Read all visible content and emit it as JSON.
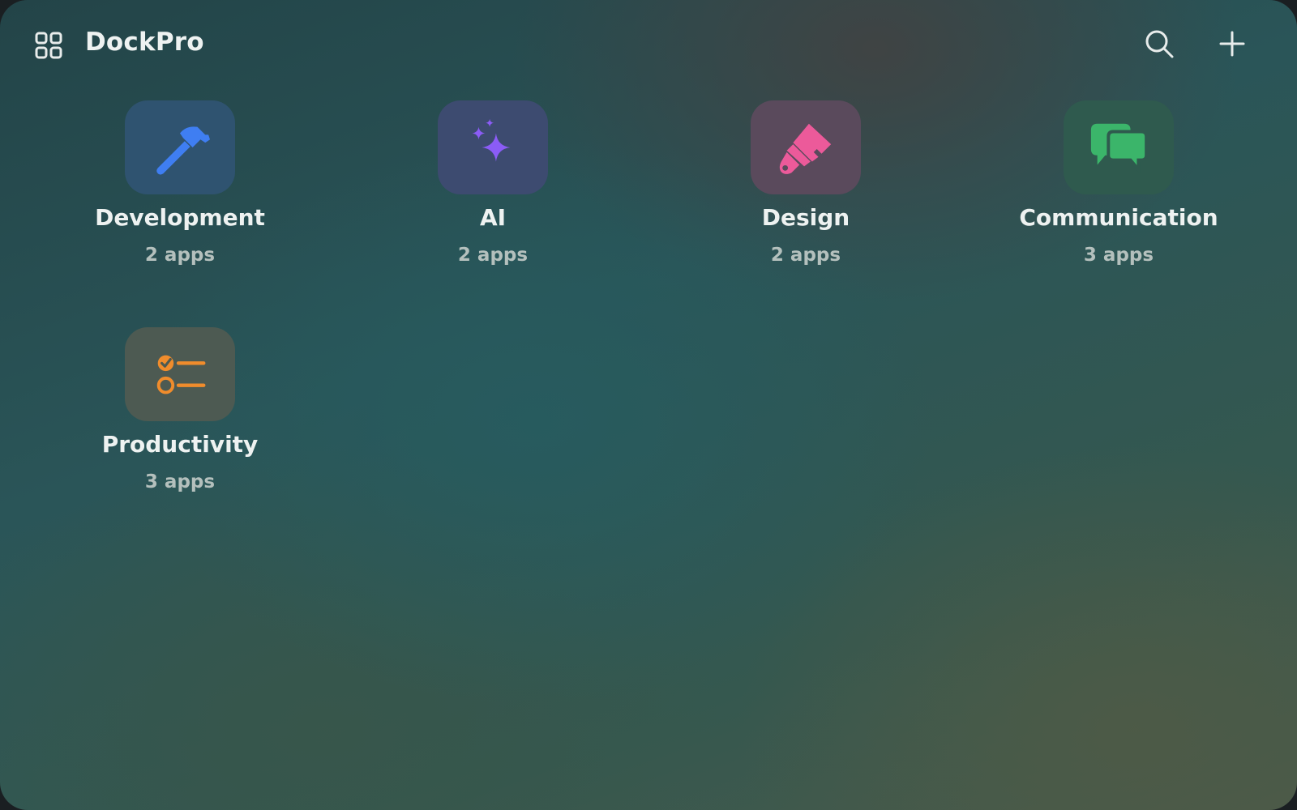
{
  "app": {
    "title": "DockPro"
  },
  "header": {
    "actions": [
      {
        "name": "search",
        "icon": "search-icon"
      },
      {
        "name": "add",
        "icon": "plus-icon"
      }
    ]
  },
  "groups": [
    {
      "name": "Development",
      "count": "2 apps",
      "icon": "hammer-icon",
      "color": "#3f7ef2",
      "tile_bg": "#2f5370"
    },
    {
      "name": "AI",
      "count": "2 apps",
      "icon": "sparkles-icon",
      "color": "#8b5cf6",
      "tile_bg": "#3d4b70"
    },
    {
      "name": "Design",
      "count": "2 apps",
      "icon": "paintbrush-icon",
      "color": "#ec5a9a",
      "tile_bg": "#5a4a5c"
    },
    {
      "name": "Communication",
      "count": "3 apps",
      "icon": "chat-bubbles-icon",
      "color": "#3bb56a",
      "tile_bg": "#2f5a4e"
    },
    {
      "name": "Productivity",
      "count": "3 apps",
      "icon": "checklist-icon",
      "color": "#f08c2c",
      "tile_bg": "#4d5a52"
    }
  ]
}
